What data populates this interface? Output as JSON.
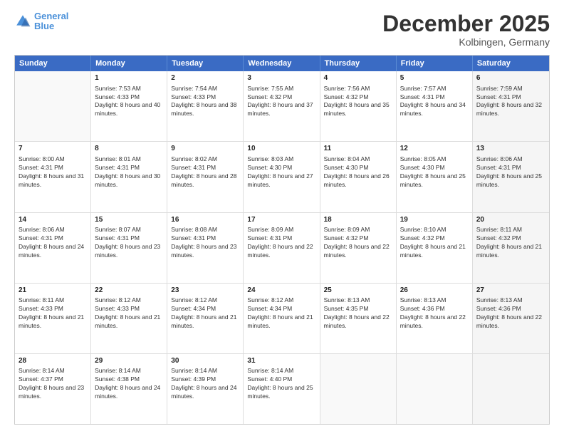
{
  "header": {
    "logo_line1": "General",
    "logo_line2": "Blue",
    "month_title": "December 2025",
    "location": "Kolbingen, Germany"
  },
  "weekdays": [
    "Sunday",
    "Monday",
    "Tuesday",
    "Wednesday",
    "Thursday",
    "Friday",
    "Saturday"
  ],
  "rows": [
    [
      {
        "day": "",
        "sunrise": "",
        "sunset": "",
        "daylight": "",
        "shaded": false,
        "empty": true
      },
      {
        "day": "1",
        "sunrise": "Sunrise: 7:53 AM",
        "sunset": "Sunset: 4:33 PM",
        "daylight": "Daylight: 8 hours and 40 minutes.",
        "shaded": false,
        "empty": false
      },
      {
        "day": "2",
        "sunrise": "Sunrise: 7:54 AM",
        "sunset": "Sunset: 4:33 PM",
        "daylight": "Daylight: 8 hours and 38 minutes.",
        "shaded": false,
        "empty": false
      },
      {
        "day": "3",
        "sunrise": "Sunrise: 7:55 AM",
        "sunset": "Sunset: 4:32 PM",
        "daylight": "Daylight: 8 hours and 37 minutes.",
        "shaded": false,
        "empty": false
      },
      {
        "day": "4",
        "sunrise": "Sunrise: 7:56 AM",
        "sunset": "Sunset: 4:32 PM",
        "daylight": "Daylight: 8 hours and 35 minutes.",
        "shaded": false,
        "empty": false
      },
      {
        "day": "5",
        "sunrise": "Sunrise: 7:57 AM",
        "sunset": "Sunset: 4:31 PM",
        "daylight": "Daylight: 8 hours and 34 minutes.",
        "shaded": false,
        "empty": false
      },
      {
        "day": "6",
        "sunrise": "Sunrise: 7:59 AM",
        "sunset": "Sunset: 4:31 PM",
        "daylight": "Daylight: 8 hours and 32 minutes.",
        "shaded": true,
        "empty": false
      }
    ],
    [
      {
        "day": "7",
        "sunrise": "Sunrise: 8:00 AM",
        "sunset": "Sunset: 4:31 PM",
        "daylight": "Daylight: 8 hours and 31 minutes.",
        "shaded": false,
        "empty": false
      },
      {
        "day": "8",
        "sunrise": "Sunrise: 8:01 AM",
        "sunset": "Sunset: 4:31 PM",
        "daylight": "Daylight: 8 hours and 30 minutes.",
        "shaded": false,
        "empty": false
      },
      {
        "day": "9",
        "sunrise": "Sunrise: 8:02 AM",
        "sunset": "Sunset: 4:31 PM",
        "daylight": "Daylight: 8 hours and 28 minutes.",
        "shaded": false,
        "empty": false
      },
      {
        "day": "10",
        "sunrise": "Sunrise: 8:03 AM",
        "sunset": "Sunset: 4:30 PM",
        "daylight": "Daylight: 8 hours and 27 minutes.",
        "shaded": false,
        "empty": false
      },
      {
        "day": "11",
        "sunrise": "Sunrise: 8:04 AM",
        "sunset": "Sunset: 4:30 PM",
        "daylight": "Daylight: 8 hours and 26 minutes.",
        "shaded": false,
        "empty": false
      },
      {
        "day": "12",
        "sunrise": "Sunrise: 8:05 AM",
        "sunset": "Sunset: 4:30 PM",
        "daylight": "Daylight: 8 hours and 25 minutes.",
        "shaded": false,
        "empty": false
      },
      {
        "day": "13",
        "sunrise": "Sunrise: 8:06 AM",
        "sunset": "Sunset: 4:31 PM",
        "daylight": "Daylight: 8 hours and 25 minutes.",
        "shaded": true,
        "empty": false
      }
    ],
    [
      {
        "day": "14",
        "sunrise": "Sunrise: 8:06 AM",
        "sunset": "Sunset: 4:31 PM",
        "daylight": "Daylight: 8 hours and 24 minutes.",
        "shaded": false,
        "empty": false
      },
      {
        "day": "15",
        "sunrise": "Sunrise: 8:07 AM",
        "sunset": "Sunset: 4:31 PM",
        "daylight": "Daylight: 8 hours and 23 minutes.",
        "shaded": false,
        "empty": false
      },
      {
        "day": "16",
        "sunrise": "Sunrise: 8:08 AM",
        "sunset": "Sunset: 4:31 PM",
        "daylight": "Daylight: 8 hours and 23 minutes.",
        "shaded": false,
        "empty": false
      },
      {
        "day": "17",
        "sunrise": "Sunrise: 8:09 AM",
        "sunset": "Sunset: 4:31 PM",
        "daylight": "Daylight: 8 hours and 22 minutes.",
        "shaded": false,
        "empty": false
      },
      {
        "day": "18",
        "sunrise": "Sunrise: 8:09 AM",
        "sunset": "Sunset: 4:32 PM",
        "daylight": "Daylight: 8 hours and 22 minutes.",
        "shaded": false,
        "empty": false
      },
      {
        "day": "19",
        "sunrise": "Sunrise: 8:10 AM",
        "sunset": "Sunset: 4:32 PM",
        "daylight": "Daylight: 8 hours and 21 minutes.",
        "shaded": false,
        "empty": false
      },
      {
        "day": "20",
        "sunrise": "Sunrise: 8:11 AM",
        "sunset": "Sunset: 4:32 PM",
        "daylight": "Daylight: 8 hours and 21 minutes.",
        "shaded": true,
        "empty": false
      }
    ],
    [
      {
        "day": "21",
        "sunrise": "Sunrise: 8:11 AM",
        "sunset": "Sunset: 4:33 PM",
        "daylight": "Daylight: 8 hours and 21 minutes.",
        "shaded": false,
        "empty": false
      },
      {
        "day": "22",
        "sunrise": "Sunrise: 8:12 AM",
        "sunset": "Sunset: 4:33 PM",
        "daylight": "Daylight: 8 hours and 21 minutes.",
        "shaded": false,
        "empty": false
      },
      {
        "day": "23",
        "sunrise": "Sunrise: 8:12 AM",
        "sunset": "Sunset: 4:34 PM",
        "daylight": "Daylight: 8 hours and 21 minutes.",
        "shaded": false,
        "empty": false
      },
      {
        "day": "24",
        "sunrise": "Sunrise: 8:12 AM",
        "sunset": "Sunset: 4:34 PM",
        "daylight": "Daylight: 8 hours and 21 minutes.",
        "shaded": false,
        "empty": false
      },
      {
        "day": "25",
        "sunrise": "Sunrise: 8:13 AM",
        "sunset": "Sunset: 4:35 PM",
        "daylight": "Daylight: 8 hours and 22 minutes.",
        "shaded": false,
        "empty": false
      },
      {
        "day": "26",
        "sunrise": "Sunrise: 8:13 AM",
        "sunset": "Sunset: 4:36 PM",
        "daylight": "Daylight: 8 hours and 22 minutes.",
        "shaded": false,
        "empty": false
      },
      {
        "day": "27",
        "sunrise": "Sunrise: 8:13 AM",
        "sunset": "Sunset: 4:36 PM",
        "daylight": "Daylight: 8 hours and 22 minutes.",
        "shaded": true,
        "empty": false
      }
    ],
    [
      {
        "day": "28",
        "sunrise": "Sunrise: 8:14 AM",
        "sunset": "Sunset: 4:37 PM",
        "daylight": "Daylight: 8 hours and 23 minutes.",
        "shaded": false,
        "empty": false
      },
      {
        "day": "29",
        "sunrise": "Sunrise: 8:14 AM",
        "sunset": "Sunset: 4:38 PM",
        "daylight": "Daylight: 8 hours and 24 minutes.",
        "shaded": false,
        "empty": false
      },
      {
        "day": "30",
        "sunrise": "Sunrise: 8:14 AM",
        "sunset": "Sunset: 4:39 PM",
        "daylight": "Daylight: 8 hours and 24 minutes.",
        "shaded": false,
        "empty": false
      },
      {
        "day": "31",
        "sunrise": "Sunrise: 8:14 AM",
        "sunset": "Sunset: 4:40 PM",
        "daylight": "Daylight: 8 hours and 25 minutes.",
        "shaded": false,
        "empty": false
      },
      {
        "day": "",
        "sunrise": "",
        "sunset": "",
        "daylight": "",
        "shaded": false,
        "empty": true
      },
      {
        "day": "",
        "sunrise": "",
        "sunset": "",
        "daylight": "",
        "shaded": false,
        "empty": true
      },
      {
        "day": "",
        "sunrise": "",
        "sunset": "",
        "daylight": "",
        "shaded": true,
        "empty": true
      }
    ]
  ]
}
